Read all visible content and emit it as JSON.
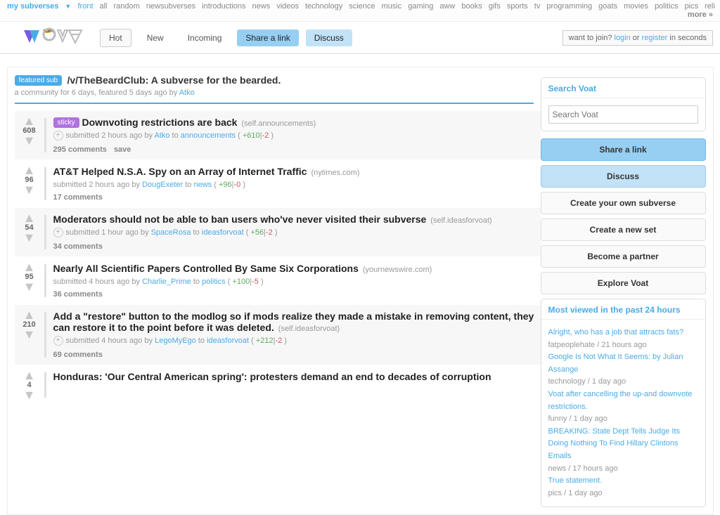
{
  "topnav": {
    "mysubverses": "my subverses",
    "items": [
      "front",
      "all",
      "random",
      "newsubverses",
      "introductions",
      "news",
      "videos",
      "technology",
      "science",
      "music",
      "gaming",
      "aww",
      "books",
      "gifs",
      "sports",
      "tv",
      "programming",
      "goats",
      "movies",
      "politics",
      "pics",
      "reli"
    ],
    "more": "more »"
  },
  "header": {
    "tabs": {
      "hot": "Hot",
      "new": "New",
      "incoming": "Incoming",
      "share": "Share a link",
      "discuss": "Discuss"
    },
    "join": {
      "prefix": "want to join? ",
      "login": "login",
      "or": " or ",
      "register": "register",
      "suffix": " in seconds"
    }
  },
  "featured": {
    "badge": "featured sub",
    "title": "/v/TheBeardClub: A subverse for the bearded.",
    "meta_prefix": "a community for 6 days, featured 5 days ago by ",
    "author": "Atko"
  },
  "posts": [
    {
      "score": "608",
      "sticky": "sticky",
      "title": "Downvoting restrictions are back",
      "domain": "(self.announcements)",
      "expand": true,
      "submitted": "submitted 2 hours ago by ",
      "author": "Atko",
      "to": " to ",
      "sub": "announcements",
      "up": "+610",
      "down": "-2",
      "comments": "295 comments",
      "save": "save",
      "shaded": true
    },
    {
      "score": "96",
      "title": "AT&T Helped N.S.A. Spy on an Array of Internet Traffic",
      "domain": "(nytimes.com)",
      "submitted": "submitted 2 hours ago by ",
      "author": "DougExeter",
      "to": " to ",
      "sub": "news",
      "up": "+96",
      "down": "-0",
      "comments": "17 comments",
      "shaded": false
    },
    {
      "score": "54",
      "title": "Moderators should not be able to ban users who've never visited their subverse",
      "domain": "(self.ideasforvoat)",
      "expand": true,
      "submitted": "submitted 1 hour ago by ",
      "author": "SpaceRosa",
      "to": " to ",
      "sub": "ideasforvoat",
      "up": "+56",
      "down": "-2",
      "comments": "34 comments",
      "shaded": true
    },
    {
      "score": "95",
      "title": "Nearly All Scientific Papers Controlled By Same Six Corporations",
      "domain": "(yournewswire.com)",
      "submitted": "submitted 4 hours ago by ",
      "author": "Charlie_Prime",
      "to": " to ",
      "sub": "politics",
      "up": "+100",
      "down": "-5",
      "comments": "36 comments",
      "shaded": false
    },
    {
      "score": "210",
      "title": "Add a \"restore\" button to the modlog so if mods realize they made a mistake in removing content, they can restore it to the point before it was deleted.",
      "domain": "(self.ideasforvoat)",
      "expand": true,
      "submitted": "submitted 4 hours ago by ",
      "author": "LegoMyEgo",
      "to": " to ",
      "sub": "ideasforvoat",
      "up": "+212",
      "down": "-2",
      "comments": "69 comments",
      "shaded": true
    },
    {
      "score": "4",
      "title": "Honduras: 'Our Central American spring': protesters demand an end to decades of corruption",
      "domain": "",
      "submitted": "",
      "author": "",
      "to": "",
      "sub": "",
      "up": "",
      "down": "",
      "comments": "",
      "shaded": false
    }
  ],
  "voteparen": {
    "open": " ( ",
    "sep": "|",
    "close": " )"
  },
  "sidebar": {
    "search_title": "Search Voat",
    "search_placeholder": "Search Voat",
    "buttons": {
      "share": "Share a link",
      "discuss": "Discuss",
      "create_sub": "Create your own subverse",
      "create_set": "Create a new set",
      "partner": "Become a partner",
      "explore": "Explore Voat"
    },
    "mv_title": "Most viewed in the past 24 hours",
    "mv": [
      {
        "t": "Alright, who has a job that attracts fats?",
        "m": "fatpeoplehate / 21 hours ago"
      },
      {
        "t": "Google Is Not What It Seems: by Julian Assange",
        "m": "technology / 1 day ago"
      },
      {
        "t": "Voat after cancelling the up-and downvote restrictions.",
        "m": "funny / 1 day ago"
      },
      {
        "t": "BREAKING: State Dept Tells Judge Its Doing Nothing To Find Hillary Clintons Emails",
        "m": "news / 17 hours ago"
      },
      {
        "t": "True statement.",
        "m": "pics / 1 day ago"
      }
    ]
  }
}
